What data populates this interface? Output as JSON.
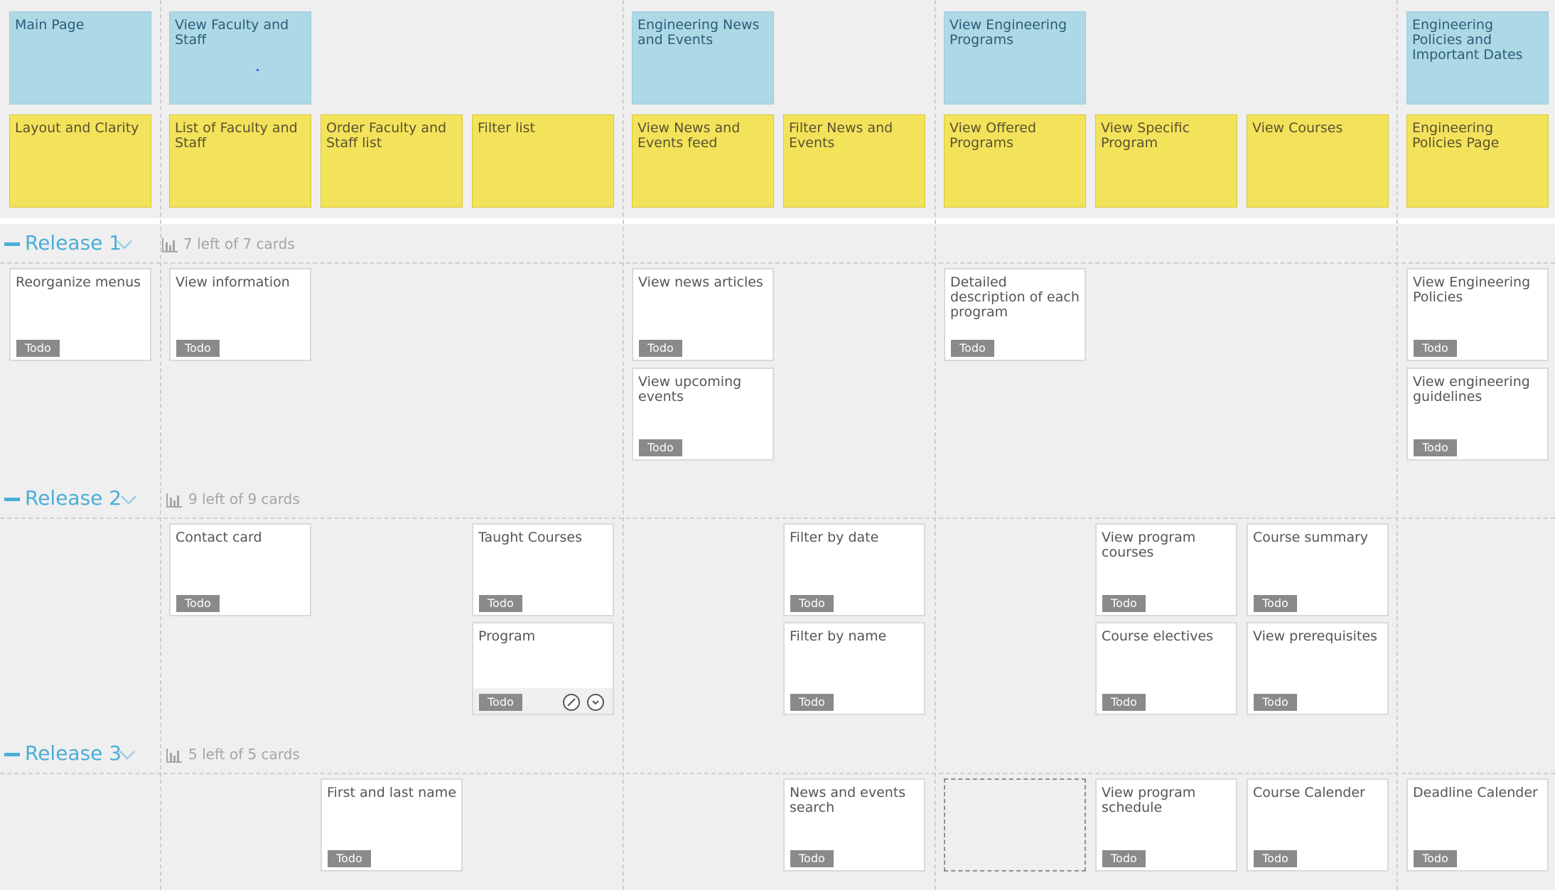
{
  "colors": {
    "activity": "#add8e6",
    "task": "#f2e35b",
    "story": "#ffffff",
    "badge": "#8a8a8a",
    "release_accent": "#4aaed8"
  },
  "activities": [
    "Main Page",
    "View Faculty and Staff",
    "Engineering News and Events",
    "View Engineering Programs",
    "Engineering Policies and Important Dates"
  ],
  "tasks": [
    "Layout and Clarity",
    "List of Faculty and Staff",
    "Order Faculty and Staff list",
    "Filter list",
    "View News and Events feed",
    "Filter News and Events",
    "View Offered Programs",
    "View Specific Program",
    "View Courses",
    "Engineering Policies Page"
  ],
  "releases": [
    {
      "name": "Release 1",
      "count": "7 left of 7 cards",
      "icons": [
        "minus-icon",
        "chevron-down-icon",
        "bar-chart-icon"
      ],
      "stories": [
        {
          "title": "Reorganize menus",
          "status": "Todo"
        },
        {
          "title": "View information",
          "status": "Todo"
        },
        {
          "title": "View news articles",
          "status": "Todo"
        },
        {
          "title": "View upcoming events",
          "status": "Todo"
        },
        {
          "title": "Detailed description of each program",
          "status": "Todo"
        },
        {
          "title": "View Engineering Policies",
          "status": "Todo"
        },
        {
          "title": "View engineering guidelines",
          "status": "Todo"
        }
      ]
    },
    {
      "name": "Release 2",
      "count": "9 left of 9 cards",
      "icons": [
        "minus-icon",
        "chevron-down-icon",
        "bar-chart-icon"
      ],
      "stories": [
        {
          "title": "Contact card",
          "status": "Todo"
        },
        {
          "title": "Taught Courses",
          "status": "Todo"
        },
        {
          "title": "Program",
          "status": "Todo",
          "actions": [
            "edit-icon",
            "expand-icon"
          ]
        },
        {
          "title": "Filter by date",
          "status": "Todo"
        },
        {
          "title": "Filter by name",
          "status": "Todo"
        },
        {
          "title": "View program courses",
          "status": "Todo"
        },
        {
          "title": "Course electives",
          "status": "Todo"
        },
        {
          "title": "Course summary",
          "status": "Todo"
        },
        {
          "title": "View prerequisites",
          "status": "Todo"
        }
      ]
    },
    {
      "name": "Release 3",
      "count": "5 left of 5 cards",
      "icons": [
        "minus-icon",
        "chevron-down-icon",
        "bar-chart-icon"
      ],
      "stories": [
        {
          "title": "First and last name",
          "status": "Todo"
        },
        {
          "title": "News and events search",
          "status": "Todo"
        },
        {
          "title": "View program schedule",
          "status": "Todo"
        },
        {
          "title": "Course Calender",
          "status": "Todo"
        },
        {
          "title": "Deadline Calender",
          "status": "Todo"
        }
      ]
    }
  ]
}
